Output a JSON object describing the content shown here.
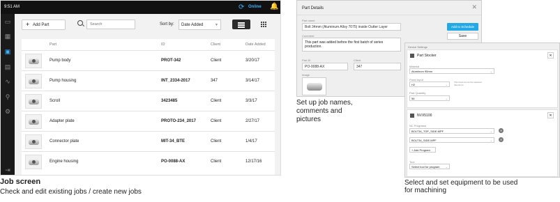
{
  "job_screen": {
    "status": {
      "time": "9:51 AM",
      "online": "Online"
    },
    "add_part": "Add Part",
    "search_placeholder": "Search",
    "sort_label": "Sort by:",
    "sort_value": "Date Added",
    "columns": {
      "part": "Part",
      "id": "ID",
      "client": "Client",
      "date": "Date Added"
    },
    "rows": [
      {
        "name": "Pump body",
        "id": "PROT-342",
        "client": "Client",
        "date": "3/20/17"
      },
      {
        "name": "Pump housing",
        "id": "INT_2334-2017",
        "client": "347",
        "date": "3/14/17"
      },
      {
        "name": "Scroll",
        "id": "3423485",
        "client": "Client",
        "date": "3/3/17"
      },
      {
        "name": "Adapter plate",
        "id": "PROTO-234_2017",
        "client": "Client",
        "date": "2/27/17"
      },
      {
        "name": "Connector plate",
        "id": "MIT-34_BTE",
        "client": "Client",
        "date": "1/4/17"
      },
      {
        "name": "Engine housing",
        "id": "PO-0088-AX",
        "client": "Client",
        "date": "12/17/16"
      }
    ],
    "caption_title": "Job screen",
    "caption_text": "Check and edit existing jobs / create new jobs"
  },
  "part_details": {
    "title": "Part Details",
    "part_name_label": "Part name",
    "part_name": "Bolt 34mm (Aluminum Alloy 7075) inside Outter Layer",
    "comment_label": "Comment",
    "comment": "This part was added before the first batch of series production.",
    "part_id_label": "Part ID",
    "part_id": "PO-0088-AX",
    "client_label": "Client",
    "client": "347",
    "image_label": "Image",
    "add_to_schedule": "Add to Schedule",
    "save": "Save",
    "caption_lines": [
      "Set up job names,",
      "comments and",
      "pictures"
    ]
  },
  "device_settings": {
    "title": "Device Settings",
    "stocker": {
      "name": "Part Stocker",
      "material_label": "Material",
      "material": "Aluminum 90mm",
      "fixed_input_label": "Fixed Input",
      "fixed_input": "H2",
      "note": "This fixed can do the selected Aluminum.",
      "part_quantity_label": "Part Quantity",
      "part_quantity": "56"
    },
    "machine": {
      "name": "NVX5100",
      "nc_programs_label": "NC Programs",
      "programs": [
        "BOLT34_TOP_SIDE.MPF",
        "BOLT34_SIDE.MPF"
      ],
      "add_program": "Add Program",
      "tool_label": "Tool",
      "tool": "Select tool for program"
    },
    "caption_lines": [
      "Select and set equipment to be used",
      "for machining"
    ]
  }
}
